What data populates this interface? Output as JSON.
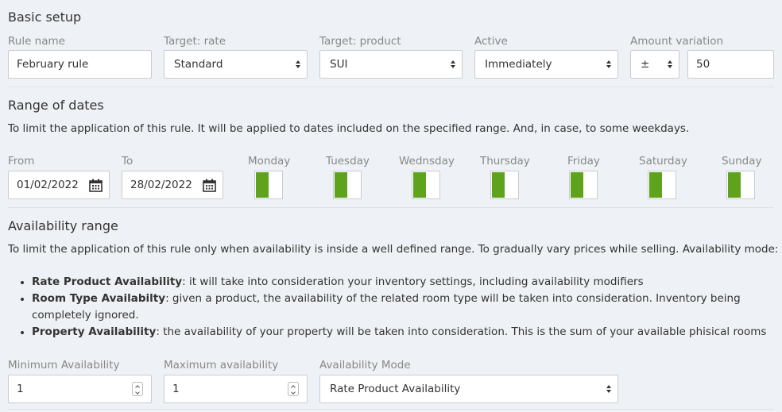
{
  "basic": {
    "title": "Basic setup",
    "rule_name_label": "Rule name",
    "rule_name_value": "February rule",
    "target_rate_label": "Target: rate",
    "target_rate_value": "Standard",
    "target_product_label": "Target: product",
    "target_product_value": "SUI",
    "active_label": "Active",
    "active_value": "Immediately",
    "amount_label": "Amount variation",
    "amount_sign": "±",
    "amount_value": "50"
  },
  "dates": {
    "title": "Range of dates",
    "description": "To limit the application of this rule. It will be applied to dates included on the specified range. And, in case, to some weekdays.",
    "from_label": "From",
    "from_value": "01/02/2022",
    "to_label": "To",
    "to_value": "28/02/2022",
    "weekdays": [
      {
        "label": "Monday",
        "on": true
      },
      {
        "label": "Tuesday",
        "on": true
      },
      {
        "label": "Wednsday",
        "on": true
      },
      {
        "label": "Thursday",
        "on": true
      },
      {
        "label": "Friday",
        "on": true
      },
      {
        "label": "Saturday",
        "on": true
      },
      {
        "label": "Sunday",
        "on": true
      }
    ]
  },
  "availability": {
    "title": "Availability range",
    "description": "To limit the application of this rule only when availability is inside a well defined range. To gradually vary prices while selling. Availability mode:",
    "modes": [
      {
        "name": "Rate Product Availability",
        "text": ": it will take into consideration your inventory settings, including availability modifiers"
      },
      {
        "name": "Room Type Availabilty",
        "text": ": given a product, the availability of the related room type will be taken into consideration. Inventory being completely ignored."
      },
      {
        "name": "Property Availability",
        "text": ": the availability of your property will be taken into consideration. This is the sum of your available phisical rooms"
      }
    ],
    "min_label": "Minimum Availability",
    "min_value": "1",
    "max_label": "Maximum availability",
    "max_value": "1",
    "mode_label": "Availability Mode",
    "mode_value": "Rate Product Availability"
  },
  "colors": {
    "toggle_on": "#5ea31b",
    "background": "#eef1f5"
  }
}
